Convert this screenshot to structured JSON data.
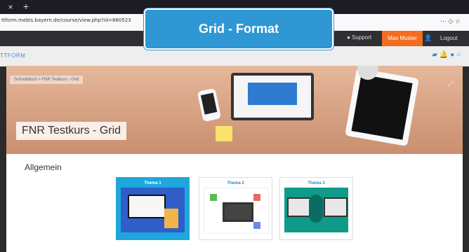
{
  "browser": {
    "url": "ttform.mebis.bayern.de/course/view.php?id=860523",
    "tab_close": "×",
    "tab_new": "+"
  },
  "topbar": {
    "support": "Support",
    "user": "Max Muster",
    "logout": "Logout"
  },
  "navbar": {
    "brand": "TTFORM"
  },
  "hero": {
    "breadcrumb": "Schreibtisch > FNR Testkurs - Grid",
    "course_title": "FNR Testkurs - Grid"
  },
  "overlay": {
    "banner_text": "Grid - Format"
  },
  "section": {
    "title": "Allgemein",
    "topics": [
      {
        "label": "Thema 1"
      },
      {
        "label": "Thema 2"
      },
      {
        "label": "Thema 3"
      }
    ]
  }
}
